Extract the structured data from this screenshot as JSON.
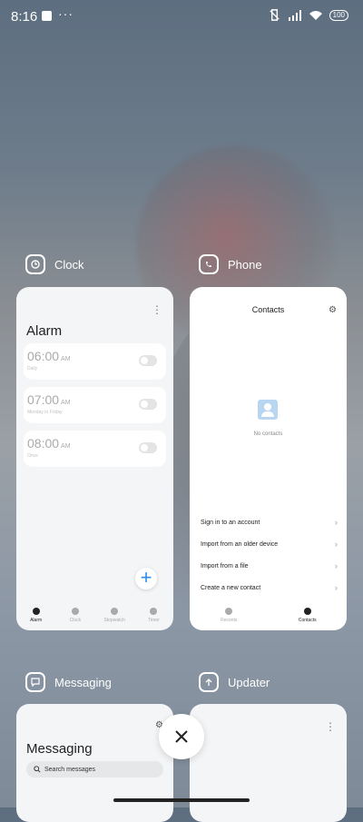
{
  "status": {
    "time": "8:16",
    "dots": "···",
    "battery": "100"
  },
  "clock": {
    "app_label": "Clock",
    "title": "Alarm",
    "alarms": [
      {
        "time": "06:00",
        "ampm": "AM",
        "sub": "Daily"
      },
      {
        "time": "07:00",
        "ampm": "AM",
        "sub": "Monday to Friday"
      },
      {
        "time": "08:00",
        "ampm": "AM",
        "sub": "Once"
      }
    ],
    "nav": [
      "Alarm",
      "Clock",
      "Stopwatch",
      "Timer"
    ]
  },
  "phone": {
    "app_label": "Phone",
    "title": "Contacts",
    "empty": "No contacts",
    "menu": [
      "Sign in to an account",
      "Import from an older device",
      "Import from a file",
      "Create a new contact"
    ],
    "nav": [
      "Recents",
      "Contacts"
    ]
  },
  "messaging": {
    "app_label": "Messaging",
    "title": "Messaging",
    "search_placeholder": "Search messages"
  },
  "updater": {
    "app_label": "Updater"
  },
  "colors": {
    "accent": "#2e8cf0"
  }
}
